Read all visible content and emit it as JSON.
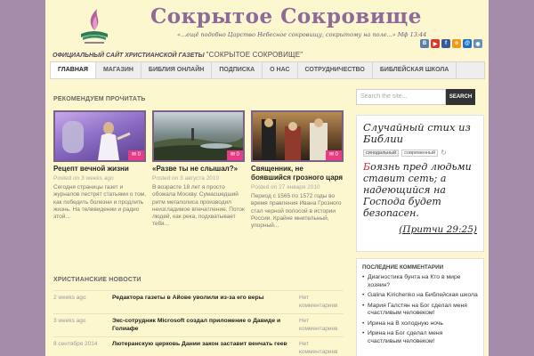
{
  "site": {
    "title": "Сокрытое Сокровище",
    "tagline": "«...ещё подобно Царство Небесное сокровищу, сокрытому на поле...» Мф 13:44",
    "subtitle_prefix": "ОФИЦИАЛЬНЫЙ САЙТ ХРИСТИАНСКОЙ ГАЗЕТЫ",
    "subtitle_name": "\"СОКРЫТОЕ СОКРОВИЩЕ\""
  },
  "social": [
    {
      "icon": "vk-icon",
      "glyph": "B",
      "color": "#5b7fa6"
    },
    {
      "icon": "youtube-icon",
      "glyph": "▶",
      "color": "#d93a2b"
    },
    {
      "icon": "facebook-icon",
      "glyph": "f",
      "color": "#3b5998"
    },
    {
      "icon": "odnoklassniki-icon",
      "glyph": "о",
      "color": "#f09a1c"
    },
    {
      "icon": "mail-icon",
      "glyph": "@",
      "color": "#1f6fc6"
    },
    {
      "icon": "rss-icon",
      "glyph": "◉",
      "color": "#6b8fb3"
    }
  ],
  "nav": [
    "ГЛАВНАЯ",
    "МАГАЗИН",
    "БИБЛИЯ ОНЛАЙН",
    "ПОДПИСКА",
    "О НАС",
    "СОТРУДНИЧЕСТВО",
    "БИБЛЕЙСКАЯ ШКОЛА"
  ],
  "recommended": {
    "title": "РЕКОМЕНДУЕМ ПРОЧИТАТЬ",
    "items": [
      {
        "title": "Рецепт вечной жизни",
        "date": "Posted on 3 weeks ago",
        "comments": "0",
        "excerpt": "Сегодня страницы газет и журналов пестрят статьями о том, как победить болезни и продлить жизнь. На телевидении и радио этой..."
      },
      {
        "title": "«Разве ты не слышал?»",
        "date": "Posted on 3 августа 2010",
        "comments": "0",
        "excerpt": "В возрасте 18 лет я просто обожала Москву. Сумасшедший ритм мегаполиса производил неизгладимое впечатление. Поток людей, как река, подхватывает тебя..."
      },
      {
        "title": "Священник, не боявшийся грозного царя",
        "date": "Posted on 27 января 2010",
        "comments": "0",
        "excerpt": "Период с 1565 по 1572 годы во время правления Ивана Грозного стал черной полосой в истории России. Крайне мнительный, упорный..."
      }
    ]
  },
  "news": {
    "title": "ХРИСТИАНСКИЕ НОВОСТИ",
    "items": [
      {
        "date": "2 weeks ago",
        "title": "Редактора газеты в Айове уволили из-за его веры",
        "comments": "Нет комментариев"
      },
      {
        "date": "3 weeks ago",
        "title": "Экс-сотрудник Microsoft создал приложение о Давиде и Голиафе",
        "comments": "Нет комментариев"
      },
      {
        "date": "8 сентября 2014",
        "title": "Лютеранскую церковь Дании закон заставит венчать геев",
        "comments": "Нет комментариев"
      }
    ]
  },
  "search": {
    "placeholder": "Search the site...",
    "button": "SEARCH"
  },
  "verse": {
    "heading": "Случайный стих из Библии",
    "tabs": [
      "синодальный",
      "современный"
    ],
    "first_letter": "Б",
    "text": "оязнь пред людьми ставит сеть; а надеющийся на Господа будет безопасен.",
    "reference": "(Притчи 29:25)"
  },
  "recent_comments": {
    "title": "ПОСЛЕДНИЕ КОММЕНТАРИИ",
    "items": [
      "Диагностика бунта на Кто в мире хозяин?",
      "Galina Kirichenko на Библейская школа",
      "Мария Галстян на Бог сделал меня счастливым человеком!",
      "Ирина на В холодную ночь",
      "Ирина на Бог сделал меня счастливым человеком!"
    ]
  }
}
